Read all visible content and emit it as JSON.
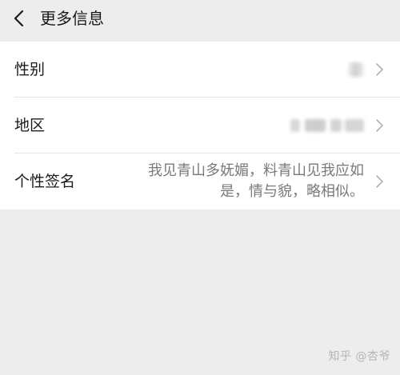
{
  "header": {
    "title": "更多信息",
    "back_icon": "chevron-left-icon"
  },
  "rows": [
    {
      "label": "性别",
      "value": "",
      "value_blurred": true
    },
    {
      "label": "地区",
      "value": "",
      "value_blurred": true
    },
    {
      "label": "个性签名",
      "value_line1": "我见青山多妩媚，料青山见我应如",
      "value_line2": "是，情与貌，略相似。"
    }
  ],
  "chevron_icon": "chevron-right-icon",
  "watermark": "知乎 @杏爷",
  "colors": {
    "background": "#ededed",
    "row_background": "#ffffff",
    "primary_text": "#1a1a1a",
    "secondary_text": "#7a7a7a",
    "chevron": "#b2b2b2"
  }
}
